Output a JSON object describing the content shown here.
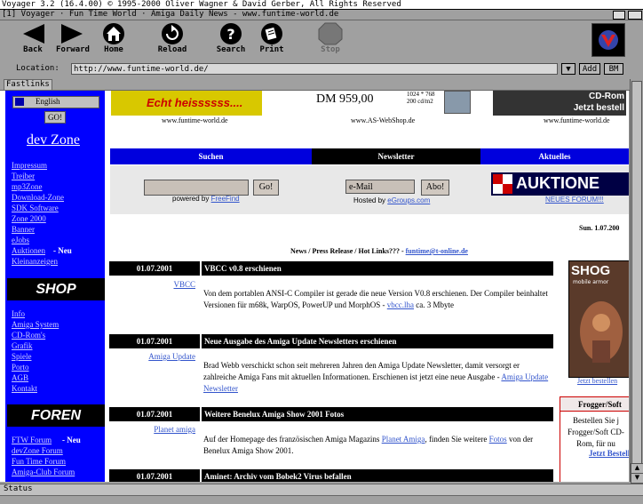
{
  "window": {
    "title": "Voyager 3.2 (16.4.00) © 1995-2000 Oliver Wagner & David Gerber, All Rights Reserved",
    "page_title": "[1] Voyager · Fun Time World · Amiga Daily News - www.funtime-world.de"
  },
  "toolbar": {
    "back": "Back",
    "forward": "Forward",
    "home": "Home",
    "reload": "Reload",
    "search": "Search",
    "print": "Print",
    "stop": "Stop"
  },
  "location": {
    "label": "Location:",
    "url": "http://www.funtime-world.de/",
    "add_label": "Add",
    "bm_label": "BM"
  },
  "fastlinks": "Fastlinks",
  "status": "Status",
  "sidebar": {
    "lang_option": "English",
    "go_label": "GO!",
    "devzone_title": "dev Zone",
    "devzone_items": [
      "Impressum",
      "Treiber",
      "mp3Zone",
      "Download-Zone",
      "SDK Software",
      "Zone 2000",
      "Banner",
      "eJobs",
      "Auktionen",
      "Kleinanzeigen"
    ],
    "neu_label": "- Neu",
    "shop_title": "SHOP",
    "shop_items": [
      "Info",
      "Amiga System",
      "CD-Rom's",
      "Grafik",
      "Spiele",
      "Porto",
      "AGB",
      "Kontakt"
    ],
    "foren_title": "FOREN",
    "foren_items": [
      "FTW Forum",
      "devZone Forum",
      "Fun Time Forum",
      "Amiga-Club Forum"
    ]
  },
  "banners": {
    "b1_text": "Echt heissssss....",
    "b1_caption": "www.funtime-world.de",
    "b2_price": "DM 959,00",
    "b2_spec": "1024 * 768\n200 cd/m2",
    "b2_caption": "www.AS-WebShop.de",
    "b3_text": "CD-Rom\nJetzt bestell",
    "b3_caption": "www.funtime-world.de"
  },
  "tabs": [
    "Suchen",
    "Newsletter",
    "Aktuelles"
  ],
  "search": {
    "go_label": "Go!",
    "powered_by": "powered by",
    "powered_link": "FreeFind"
  },
  "newsletter": {
    "placeholder": "e-Mail",
    "submit_label": "Abo!",
    "hosted_by": "Hosted by",
    "hosted_link": "eGroups.com"
  },
  "auktion": {
    "text": "AUKTIONE",
    "link": "NEUES FORUM!!!"
  },
  "date_right": "Sun. 1.07.200",
  "news_header": {
    "text": "News / Press Release / Hot Links??? -",
    "email": "funtime@t-online.de"
  },
  "news": [
    {
      "date": "01.07.2001",
      "title": "VBCC v0.8 erschienen",
      "link": "VBCC",
      "text_before": "Von dem portablen ANSI-C Compiler ist gerade die neue Version V0.8 erschienen. Der Compiler beinhaltet Versionen für m68k, WarpOS, PowerUP und MorphOS -",
      "inline_link": "vbcc.lha",
      "text_after": "ca. 3 Mbyte"
    },
    {
      "date": "01.07.2001",
      "title": "Neue Ausgabe des Amiga Update Newsletters erschienen",
      "link": "Amiga Update",
      "text_before": "Brad Webb verschickt schon seit mehreren Jahren den Amiga Update Newsletter, damit versorgt er zahlreiche Amiga Fans mit aktuellen Informationen. Erschienen ist jetzt eine neue Ausgabe -",
      "inline_link": "Amiga Update Newsletter",
      "text_after": ""
    },
    {
      "date": "01.07.2001",
      "title": "Weitere Benelux Amiga Show 2001 Fotos",
      "link": "Planet amiga",
      "text_before": "Auf der Homepage des französischen Amiga Magazins",
      "inline_link": "Planet Amiga",
      "text_after": ", finden Sie weitere",
      "inline_link2": "Fotos",
      "text_after2": "von der Benelux Amiga Show 2001."
    },
    {
      "date": "01.07.2001",
      "title": "Aminet: Archiv vom Bobek2 Virus befallen"
    }
  ],
  "right_ad": {
    "game_title": "SHOG",
    "game_sub": "mobile armor",
    "game_link": "Jetzt bestellen",
    "box_title": "Frogger/Soft",
    "box_text": "Bestellen Sie j Frogger/Soft CD-Rom, für nu",
    "box_link": "Jetzt Bestellen"
  },
  "colors": {
    "chrome": "#a0a0a0",
    "nav_blue": "#0000ff",
    "link_blue": "#3355cc",
    "header_black": "#000000"
  }
}
